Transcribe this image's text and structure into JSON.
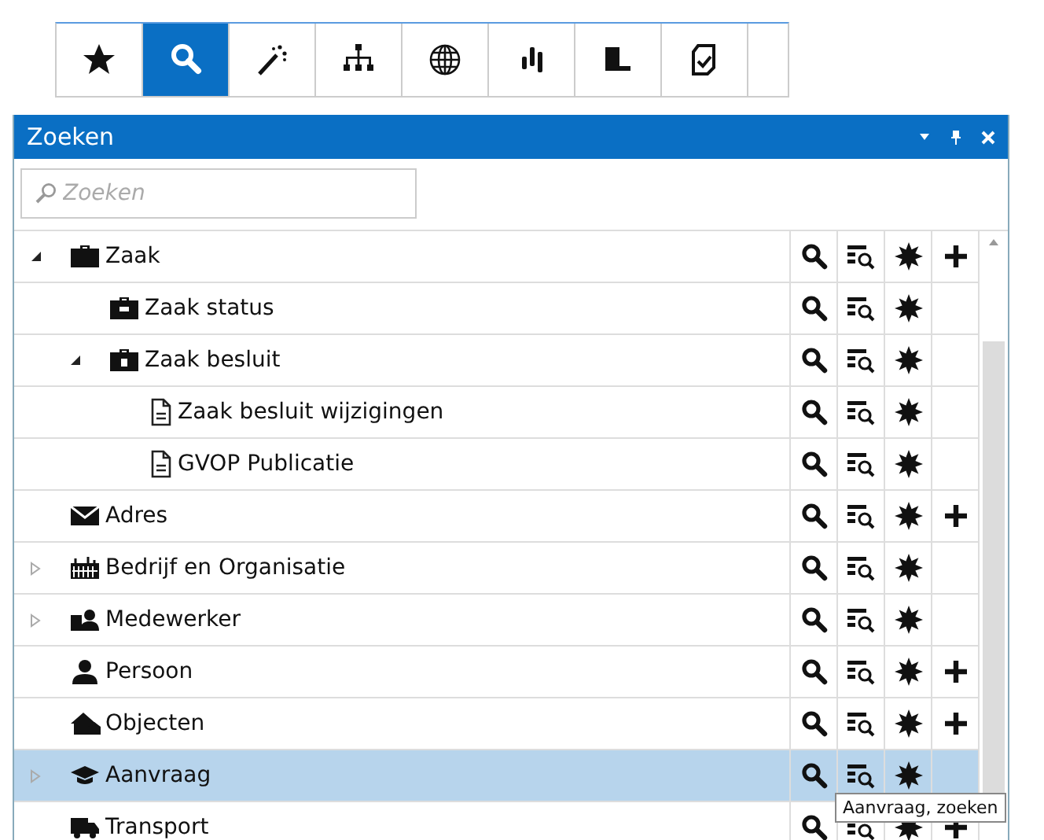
{
  "toolbar": [
    {
      "kind": "star",
      "selected": false
    },
    {
      "kind": "search",
      "selected": true
    },
    {
      "kind": "wand",
      "selected": false
    },
    {
      "kind": "hierarchy",
      "selected": false
    },
    {
      "kind": "globe",
      "selected": false
    },
    {
      "kind": "bars",
      "selected": false
    },
    {
      "kind": "block",
      "selected": false
    },
    {
      "kind": "check",
      "selected": false
    }
  ],
  "panel": {
    "title": "Zoeken",
    "search": {
      "placeholder": "Zoeken"
    },
    "tree": [
      {
        "label": "Zaak",
        "kind": "briefcase",
        "expandable": true,
        "expanded": true,
        "selected": false,
        "add": true,
        "children": [
          {
            "label": "Zaak status",
            "kind": "status",
            "expandable": false,
            "selected": false,
            "add": false
          },
          {
            "label": "Zaak besluit",
            "kind": "decision",
            "expandable": true,
            "expanded": true,
            "selected": false,
            "add": false,
            "children": [
              {
                "label": "Zaak besluit wijzigingen",
                "kind": "document",
                "expandable": false,
                "selected": false,
                "add": false
              },
              {
                "label": "GVOP Publicatie",
                "kind": "document",
                "expandable": false,
                "selected": false,
                "add": false
              }
            ]
          }
        ]
      },
      {
        "label": "Adres",
        "kind": "envelope",
        "expandable": false,
        "selected": false,
        "add": true
      },
      {
        "label": "Bedrijf en Organisatie",
        "kind": "building",
        "expandable": true,
        "expanded": false,
        "selected": false,
        "add": false
      },
      {
        "label": "Medewerker",
        "kind": "people",
        "expandable": true,
        "expanded": false,
        "selected": false,
        "add": false
      },
      {
        "label": "Persoon",
        "kind": "person",
        "expandable": false,
        "selected": false,
        "add": true
      },
      {
        "label": "Objecten",
        "kind": "house",
        "expandable": false,
        "selected": false,
        "add": true
      },
      {
        "label": "Aanvraag",
        "kind": "cap",
        "expandable": true,
        "expanded": false,
        "selected": true,
        "add": false
      },
      {
        "label": "Transport",
        "kind": "truck",
        "expandable": false,
        "selected": false,
        "add": true
      }
    ],
    "tooltip": "Aanvraag, zoeken"
  }
}
